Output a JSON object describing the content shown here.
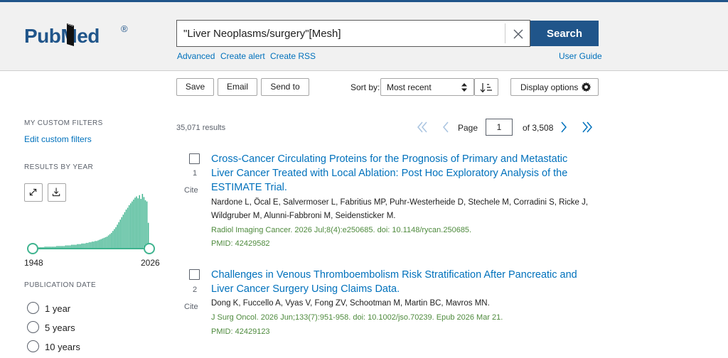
{
  "header": {
    "logo_text": "PubMed",
    "logo_reg": "®",
    "search_value": "\"Liver Neoplasms/surgery\"[Mesh]",
    "search_button": "Search",
    "links": {
      "advanced": "Advanced",
      "create_alert": "Create alert",
      "create_rss": "Create RSS",
      "user_guide": "User Guide"
    }
  },
  "toolbar": {
    "save": "Save",
    "email": "Email",
    "send_to": "Send to",
    "sort_by_label": "Sort by:",
    "sort_selected": "Most recent",
    "display_options": "Display options"
  },
  "sidebar": {
    "custom_filters_heading": "MY CUSTOM FILTERS",
    "edit_custom_filters": "Edit custom filters",
    "results_by_year_heading": "RESULTS BY YEAR",
    "year_start": "1948",
    "year_end": "2026",
    "publication_date_heading": "PUBLICATION DATE",
    "date_options": [
      "1 year",
      "5 years",
      "10 years"
    ]
  },
  "chart_data": {
    "type": "bar",
    "x_range": [
      1948,
      2026
    ],
    "values": [
      1,
      1,
      1,
      1,
      1,
      1,
      1,
      1,
      2,
      2,
      2,
      2,
      2,
      2,
      2,
      2,
      3,
      3,
      3,
      3,
      3,
      3,
      4,
      4,
      4,
      4,
      5,
      5,
      5,
      5,
      6,
      6,
      6,
      7,
      7,
      7,
      8,
      8,
      9,
      9,
      10,
      10,
      11,
      11,
      12,
      13,
      14,
      15,
      16,
      17,
      18,
      20,
      22,
      24,
      27,
      30,
      33,
      37,
      41,
      45,
      49,
      53,
      57,
      61,
      64,
      68,
      71,
      74,
      77,
      80,
      82,
      79,
      84,
      78,
      86,
      81,
      76,
      74,
      40
    ],
    "xlabel": "",
    "ylabel": "",
    "bar_color": "#3fb48f"
  },
  "results": {
    "count_text": "35,071 results",
    "page_label": "Page",
    "page_value": "1",
    "page_of": "of 3,508",
    "items": [
      {
        "num": "1",
        "cite": "Cite",
        "title_lines": [
          "Cross-Cancer Circulating Proteins for the Prognosis of Primary and Metastatic",
          "Liver Cancer Treated with Local Ablation: Post Hoc Exploratory Analysis of the",
          "ESTIMATE Trial."
        ],
        "author_lines": [
          "Nardone L, Öcal E, Salvermoser L, Fabritius MP, Puhr-Westerheide D, Stechele M, Corradini S, Ricke J,",
          "Wildgruber M, Alunni-Fabbroni M, Seidensticker M."
        ],
        "journal": "Radiol Imaging Cancer. 2026 Jul;8(4):e250685. doi: 10.1148/rycan.250685.",
        "pmid": "PMID: 42429582"
      },
      {
        "num": "2",
        "cite": "Cite",
        "title_lines": [
          "Challenges in Venous Thromboembolism Risk Stratification After Pancreatic and",
          "Liver Cancer Surgery Using Claims Data."
        ],
        "author_lines": [
          "Dong K, Fuccello A, Vyas V, Fong ZV, Schootman M, Martin BC, Mavros MN."
        ],
        "journal": "J Surg Oncol. 2026 Jun;133(7):951-958. doi: 10.1002/jso.70239. Epub 2026 Mar 21.",
        "pmid": "PMID: 42429123"
      }
    ]
  },
  "colors": {
    "brand_blue": "#20558a",
    "link_blue": "#0071bc",
    "journal_green": "#4e8a3d",
    "chart_green": "#3fb48f",
    "header_bg": "#f1f1f1"
  }
}
